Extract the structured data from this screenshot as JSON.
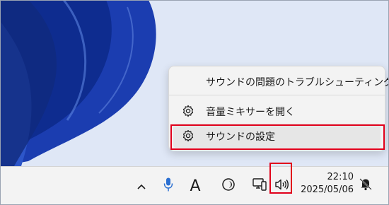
{
  "context_menu": {
    "items": [
      {
        "label": "サウンドの問題のトラブルシューティング",
        "icon": null
      },
      {
        "label": "音量ミキサーを開く",
        "icon": "gear-icon"
      },
      {
        "label": "サウンドの設定",
        "icon": "gear-icon",
        "state": "hovered",
        "annotation": "red-highlight-box"
      }
    ]
  },
  "taskbar": {
    "tray_icons": [
      "chevron-up-icon",
      "microphone-icon",
      "ime-mode-indicator",
      "focus-assist-icon",
      "network-icon",
      "volume-icon"
    ],
    "ime_indicator": "A",
    "clock": {
      "time": "22:10",
      "date": "2025/05/06"
    },
    "notification_icon": "bell-icon"
  },
  "colors": {
    "taskbar_bg": "#f3f3f3",
    "menu_bg": "#f3f3f3",
    "highlight_red": "#e1001b",
    "mic_blue": "#2a6fd1",
    "wallpaper_blue": "#1b3db0",
    "wallpaper_bg": "#dfe7f6"
  }
}
